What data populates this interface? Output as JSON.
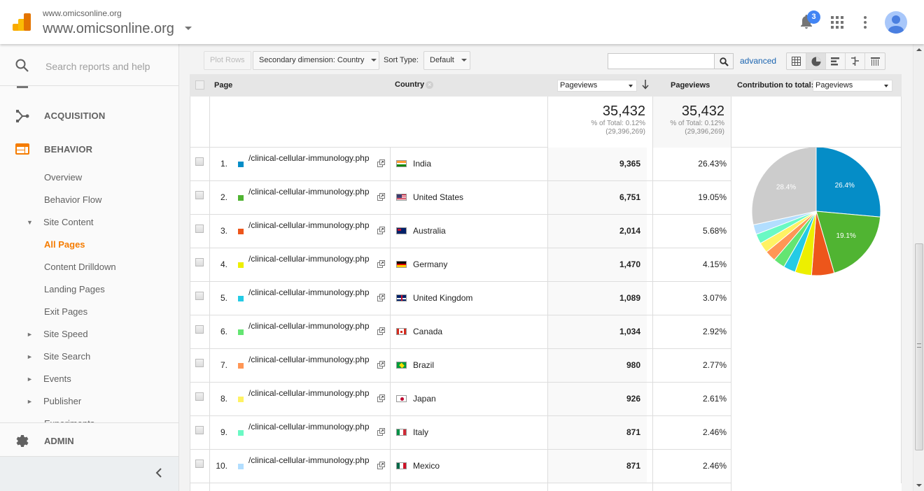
{
  "header": {
    "account_small": "www.omicsonline.org",
    "account_big": "www.omicsonline.org",
    "notification_count": "3",
    "icons": [
      "analytics-logo",
      "bell-icon",
      "apps-grid-icon",
      "more-vert-icon",
      "avatar-icon"
    ]
  },
  "sidebar": {
    "search_placeholder": "Search reports and help",
    "sections": {
      "acquisition": "ACQUISITION",
      "behavior": "BEHAVIOR",
      "admin": "ADMIN"
    },
    "items": [
      {
        "label": "Overview",
        "arrow": ""
      },
      {
        "label": "Behavior Flow",
        "arrow": ""
      },
      {
        "label": "Site Content",
        "arrow": "▼"
      },
      {
        "label": "All Pages",
        "arrow": "",
        "active": true
      },
      {
        "label": "Content Drilldown",
        "arrow": ""
      },
      {
        "label": "Landing Pages",
        "arrow": ""
      },
      {
        "label": "Exit Pages",
        "arrow": ""
      },
      {
        "label": "Site Speed",
        "arrow": "►"
      },
      {
        "label": "Site Search",
        "arrow": "►"
      },
      {
        "label": "Events",
        "arrow": "►"
      },
      {
        "label": "Publisher",
        "arrow": "►"
      },
      {
        "label": "Experiments",
        "arrow": ""
      }
    ],
    "accent_color": "#f57c00"
  },
  "toolbar": {
    "plot_rows": "Plot Rows",
    "secondary_dimension": "Secondary dimension: Country",
    "sort_type_label": "Sort Type:",
    "sort_type_value": "Default",
    "search_value": "",
    "advanced": "advanced",
    "views": [
      "table-view",
      "pie-view",
      "bar-view",
      "comparison-view",
      "pivot-view"
    ],
    "active_view": "pie-view"
  },
  "table": {
    "headers": {
      "page": "Page",
      "country": "Country",
      "metric_select": "Pageviews",
      "pageviews": "Pageviews",
      "contribution_label": "Contribution to total:",
      "contribution_select": "Pageviews"
    },
    "totals": [
      {
        "value": "35,432",
        "pct": "% of Total: 0.12%",
        "total": "(29,396,269)"
      },
      {
        "value": "35,432",
        "pct": "% of Total: 0.12%",
        "total": "(29,396,269)"
      }
    ],
    "rows": [
      {
        "num": "1.",
        "page": "/clinical-cellular-immunology.php",
        "country": "India",
        "flag": "in",
        "pageviews": "9,365",
        "pct": "26.43%",
        "color": "#058dc7"
      },
      {
        "num": "2.",
        "page": "/clinical-cellular-immunology.php",
        "country": "United States",
        "flag": "us",
        "pageviews": "6,751",
        "pct": "19.05%",
        "color": "#50b432"
      },
      {
        "num": "3.",
        "page": "/clinical-cellular-immunology.php",
        "country": "Australia",
        "flag": "au",
        "pageviews": "2,014",
        "pct": "5.68%",
        "color": "#ed561b"
      },
      {
        "num": "4.",
        "page": "/clinical-cellular-immunology.php",
        "country": "Germany",
        "flag": "de",
        "pageviews": "1,470",
        "pct": "4.15%",
        "color": "#edef00"
      },
      {
        "num": "5.",
        "page": "/clinical-cellular-immunology.php",
        "country": "United Kingdom",
        "flag": "gb",
        "pageviews": "1,089",
        "pct": "3.07%",
        "color": "#24cbe5"
      },
      {
        "num": "6.",
        "page": "/clinical-cellular-immunology.php",
        "country": "Canada",
        "flag": "ca",
        "pageviews": "1,034",
        "pct": "2.92%",
        "color": "#64e572"
      },
      {
        "num": "7.",
        "page": "/clinical-cellular-immunology.php",
        "country": "Brazil",
        "flag": "br",
        "pageviews": "980",
        "pct": "2.77%",
        "color": "#ff9655"
      },
      {
        "num": "8.",
        "page": "/clinical-cellular-immunology.php",
        "country": "Japan",
        "flag": "jp",
        "pageviews": "926",
        "pct": "2.61%",
        "color": "#fff263"
      },
      {
        "num": "9.",
        "page": "/clinical-cellular-immunology.php",
        "country": "Italy",
        "flag": "it",
        "pageviews": "871",
        "pct": "2.46%",
        "color": "#6af9c4"
      },
      {
        "num": "10.",
        "page": "/clinical-cellular-immunology.php",
        "country": "Mexico",
        "flag": "mx",
        "pageviews": "871",
        "pct": "2.46%",
        "color": "#b2deff"
      }
    ]
  },
  "chart_data": {
    "type": "pie",
    "title": "Contribution to total: Pageviews",
    "categories": [
      "India",
      "United States",
      "Australia",
      "Germany",
      "United Kingdom",
      "Canada",
      "Brazil",
      "Japan",
      "Italy",
      "Mexico",
      "Other"
    ],
    "values": [
      26.43,
      19.05,
      5.68,
      4.15,
      3.07,
      2.92,
      2.77,
      2.61,
      2.46,
      2.46,
      28.4
    ],
    "colors": [
      "#058dc7",
      "#50b432",
      "#ed561b",
      "#edef00",
      "#24cbe5",
      "#64e572",
      "#ff9655",
      "#fff263",
      "#6af9c4",
      "#b2deff",
      "#cccccc"
    ],
    "data_labels": {
      "India": "26.4%",
      "United States": "19.1%",
      "Other": "28.4%"
    }
  }
}
